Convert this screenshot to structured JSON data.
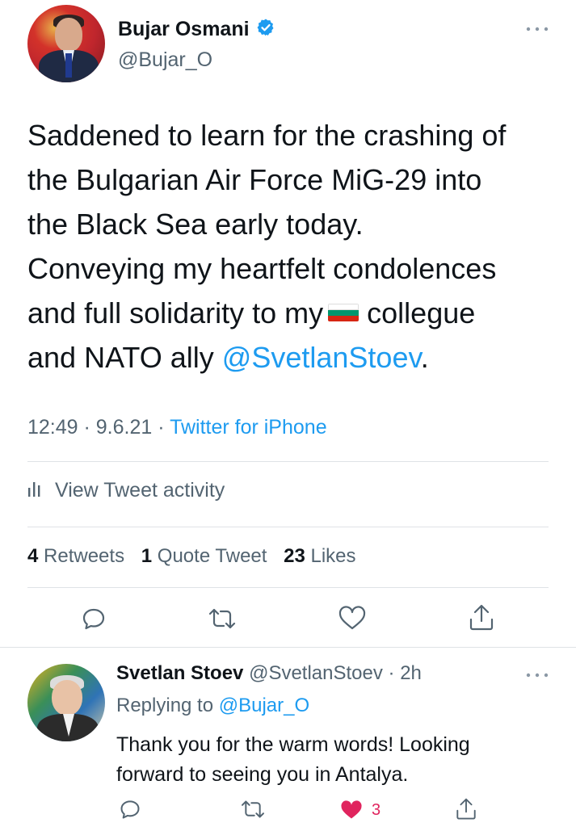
{
  "tweet": {
    "author": {
      "name": "Bujar Osmani",
      "handle": "@Bujar_O",
      "verified": true,
      "avatar_icon": "profile-photo"
    },
    "more_icon": "more-icon",
    "text_lines": [
      "Saddened to learn for the crashing of",
      "the Bulgarian Air Force MiG-29 into",
      "the Black Sea early today.",
      "Conveying my heartfelt condolences",
      "and full solidarity to my",
      "collegue",
      "and NATO ally",
      "@SvetlanStoev",
      "."
    ],
    "flag": {
      "name": "bulgaria-flag",
      "colors": [
        "#ffffff",
        "#00966e",
        "#d62612"
      ]
    },
    "time": "12:49",
    "date": "9.6.21",
    "source": "Twitter for iPhone",
    "separator": " · ",
    "activity_label": "View Tweet activity",
    "stats": {
      "retweets_count": "4",
      "retweets_label": "Retweets",
      "quotes_count": "1",
      "quotes_label": "Quote Tweet",
      "likes_count": "23",
      "likes_label": "Likes"
    },
    "actions": [
      "reply-icon",
      "retweet-icon",
      "like-icon",
      "share-icon"
    ]
  },
  "reply": {
    "author": {
      "name": "Svetlan Stoev",
      "handle": "@SvetlanStoev",
      "time": "2h",
      "separator": " · "
    },
    "replying_to_label": "Replying to",
    "replying_to_handle": "@Bujar_O",
    "text_lines": [
      "Thank you for the warm words! Looking",
      "forward to seeing you in Antalya."
    ],
    "like_count": "3",
    "liked": true
  },
  "colors": {
    "link": "#1d9bf0",
    "text": "#0f1419",
    "secondary": "#536471",
    "liked": "#e0245e"
  }
}
